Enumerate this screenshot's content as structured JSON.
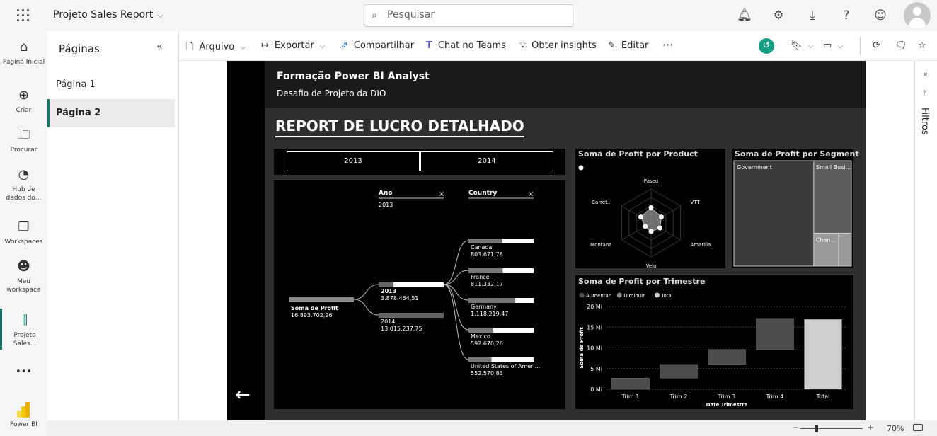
{
  "topbar": {
    "app_name": "Projeto Sales Report",
    "search_placeholder": "Pesquisar"
  },
  "nav": {
    "home": "Página Inicial",
    "create": "Criar",
    "browse": "Procurar",
    "datahub": "Hub de dados do...",
    "workspaces": "Workspaces",
    "my_workspace": "Meu workspace",
    "project": "Projeto Sales...",
    "more": "•••",
    "powerbi": "Power BI"
  },
  "pages": {
    "title": "Páginas",
    "items": [
      "Página 1",
      "Página 2"
    ]
  },
  "toolbar": {
    "arquivo": "Arquivo",
    "exportar": "Exportar",
    "compartilhar": "Compartilhar",
    "chat_teams": "Chat no Teams",
    "insights": "Obter insights",
    "editar": "Editar",
    "more": "···"
  },
  "filters": {
    "label": "Filtros"
  },
  "report": {
    "header_title": "Formação Power BI Analyst",
    "header_subtitle": "Desafio de Projeto da DIO",
    "title": "REPORT DE LUCRO DETALHADO",
    "slicer": [
      "2013",
      "2014"
    ],
    "tree": {
      "col1": "Ano",
      "col1_value": "2013",
      "col2": "Country",
      "root_label": "Soma de Profit",
      "root_value": "16.893.702,26",
      "years": [
        {
          "label": "2013",
          "value": "3.878.464,51",
          "share": 0.23
        },
        {
          "label": "2014",
          "value": "13.015.237,75",
          "share": 0.77
        }
      ],
      "countries": [
        {
          "label": "Canada",
          "value": "803.671,78",
          "share": 0.72
        },
        {
          "label": "France",
          "value": "811.332,17",
          "share": 0.73
        },
        {
          "label": "Germany",
          "value": "1.118.219,47",
          "share": 1.0
        },
        {
          "label": "Mexico",
          "value": "592.670,26",
          "share": 0.53
        },
        {
          "label": "United States of Ameri...",
          "value": "552.570,83",
          "share": 0.49
        }
      ]
    },
    "product_title": "Soma de Profit por Product",
    "segment_title": "Soma de Profit por Segment",
    "segment_labels": [
      "Government",
      "Small Busi...",
      "Chan..."
    ],
    "trim_title": "Soma de Profit por Trimestre",
    "trim_legend": [
      "Aumentar",
      "Diminuir",
      "Total"
    ]
  },
  "chart_data": [
    {
      "type": "radar",
      "title": "Soma de Profit por Product",
      "categories": [
        "Paseo",
        "VTT",
        "Amarilla",
        "Velo",
        "Montana",
        "Carret..."
      ],
      "values": [
        0.45,
        0.35,
        0.3,
        0.25,
        0.2,
        0.35
      ]
    },
    {
      "type": "treemap",
      "title": "Soma de Profit por Segment",
      "categories": [
        "Government",
        "Small Busi...",
        "Chan..."
      ],
      "values": [
        0.68,
        0.22,
        0.1
      ]
    },
    {
      "type": "bar",
      "subtype": "waterfall",
      "title": "Soma de Profit por Trimestre",
      "xlabel": "Date Trimestre",
      "ylabel": "Soma de Profit",
      "categories": [
        "Trim 1",
        "Trim 2",
        "Trim 3",
        "Trim 4",
        "Total"
      ],
      "values": [
        2.7,
        3.3,
        3.6,
        7.5,
        16.9
      ],
      "ylim": [
        0,
        20
      ],
      "yticks": [
        "0 Mi",
        "5 Mi",
        "10 Mi",
        "15 Mi",
        "20 Mi"
      ],
      "legend": [
        "Aumentar",
        "Diminuir",
        "Total"
      ]
    }
  ],
  "status": {
    "zoom": "70%",
    "minus": "−",
    "plus": "+"
  }
}
